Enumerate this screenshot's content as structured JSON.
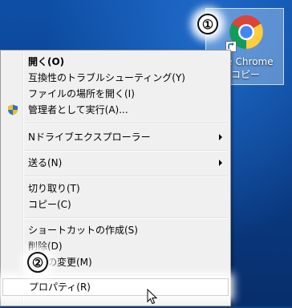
{
  "desktop_icon": {
    "label_line1": "gle Chrome",
    "label_line2": "コピー"
  },
  "annotations": {
    "step1": "①",
    "step2": "②"
  },
  "menu": {
    "items": [
      {
        "label": "開く(O)"
      },
      {
        "label": "互換性のトラブルシューティング(Y)"
      },
      {
        "label": "ファイルの場所を開く(I)"
      },
      {
        "label": "管理者として実行(A)..."
      },
      {
        "label": "Nドライブエクスプローラー"
      },
      {
        "label": "送る(N)"
      },
      {
        "label": "切り取り(T)"
      },
      {
        "label": "コピー(C)"
      },
      {
        "label": "ショートカットの作成(S)"
      },
      {
        "label": "削除(D)"
      },
      {
        "label": "名前の変更(M)"
      },
      {
        "label": "プロパティ(R)"
      }
    ]
  },
  "icons": {
    "desktop_icon": "chrome-icon",
    "shortcut_overlay": "shortcut-arrow-icon",
    "run_as_admin": "uac-shield-icon",
    "submenu": "chevron-right-icon",
    "pointer": "mouse-cursor-icon"
  },
  "colors": {
    "desktop_background": "#0b3f8a",
    "menu_background": "#f0f0f0",
    "icon_selection": "#cce8ff"
  }
}
